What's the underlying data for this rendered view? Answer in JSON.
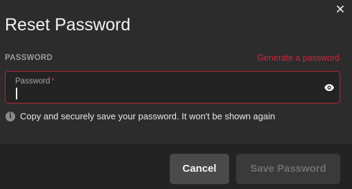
{
  "dialog": {
    "title": "Reset Password",
    "close_icon": "close-icon"
  },
  "password_section": {
    "label": "PASSWORD",
    "generate_link": "Generate a password",
    "field": {
      "label": "Password",
      "required_mark": "*",
      "value": "",
      "toggle_icon": "eye-icon"
    },
    "hint": {
      "icon": "info-icon",
      "icon_glyph": "i",
      "text": "Copy and securely save your password. It won't be shown again"
    }
  },
  "footer": {
    "cancel_label": "Cancel",
    "save_label": "Save Password",
    "save_enabled": false
  },
  "colors": {
    "background": "#2c2c2c",
    "footer_background": "#232323",
    "accent_red": "#c8283c",
    "field_border": "#b8233a"
  }
}
